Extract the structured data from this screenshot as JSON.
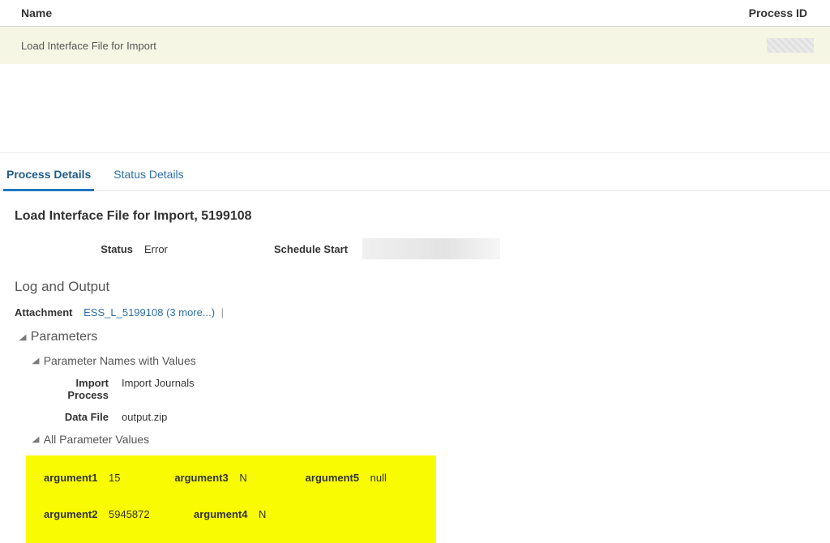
{
  "table": {
    "header_name": "Name",
    "header_pid": "Process ID",
    "row_name": "Load Interface File for Import"
  },
  "tabs": {
    "process_details": "Process Details",
    "status_details": "Status Details"
  },
  "details": {
    "title": "Load Interface File for Import, 5199108",
    "status_label": "Status",
    "status_value": "Error",
    "schedule_label": "Schedule Start"
  },
  "log": {
    "heading": "Log and Output",
    "attachment_label": "Attachment",
    "attachment_link": "ESS_L_5199108 (3 more...)"
  },
  "params": {
    "heading": "Parameters",
    "names_heading": "Parameter Names with Values",
    "import_process_label": "Import Process",
    "import_process_value": "Import Journals",
    "data_file_label": "Data File",
    "data_file_value": "output.zip",
    "all_heading": "All Parameter Values",
    "args": {
      "a1_name": "argument1",
      "a1_value": "15",
      "a2_name": "argument2",
      "a2_value": "5945872",
      "a3_name": "argument3",
      "a3_value": "N",
      "a4_name": "argument4",
      "a4_value": "N",
      "a5_name": "argument5",
      "a5_value": "null"
    }
  }
}
